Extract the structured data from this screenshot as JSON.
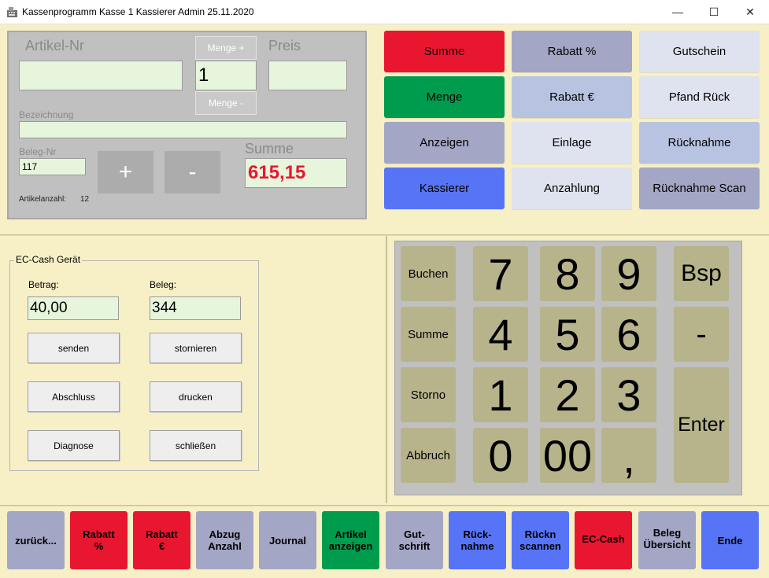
{
  "window": {
    "title": "Kassenprogramm Kasse 1  Kassierer Admin  25.11.2020",
    "minimize": "—",
    "maximize": "☐",
    "close": "✕"
  },
  "entry": {
    "artikel_label": "Artikel-Nr",
    "artikel_value": "",
    "menge_plus": "Menge +",
    "menge_value": "1",
    "menge_minus": "Menge -",
    "preis_label": "Preis",
    "preis_value": "",
    "bezeichnung_label": "Bezeichnung",
    "bezeichnung_value": "",
    "beleg_label": "Beleg-Nr",
    "beleg_value": "117",
    "plus": "+",
    "minus": "-",
    "summe_label": "Summe",
    "summe_value": "615,15",
    "artikelanzahl_label": "Artikelanzahl:",
    "artikelanzahl_value": "12"
  },
  "functions": [
    {
      "label": "Summe",
      "color": "#e8172f"
    },
    {
      "label": "Rabatt %",
      "color": "#a3a6c4"
    },
    {
      "label": "Gutschein",
      "color": "#dfe2ef"
    },
    {
      "label": "Menge",
      "color": "#009c4e"
    },
    {
      "label": "Rabatt €",
      "color": "#b7c3e1"
    },
    {
      "label": "Pfand Rück",
      "color": "#dfe2ef"
    },
    {
      "label": "Anzeigen",
      "color": "#a3a6c4"
    },
    {
      "label": "Einlage",
      "color": "#dfe2ef"
    },
    {
      "label": "Rücknahme",
      "color": "#b7c3e1"
    },
    {
      "label": "Kassierer",
      "color": "#5774f6"
    },
    {
      "label": "Anzahlung",
      "color": "#dfe2ef"
    },
    {
      "label": "Rücknahme Scan",
      "color": "#a3a6c4"
    }
  ],
  "ec": {
    "group_label": "EC-Cash Gerät",
    "betrag_label": "Betrag:",
    "betrag_value": "40,00",
    "beleg_label": "Beleg:",
    "beleg_value": "344",
    "senden": "senden",
    "stornieren": "stornieren",
    "abschluss": "Abschluss",
    "drucken": "drucken",
    "diagnose": "Diagnose",
    "schliessen": "schließen"
  },
  "keypad": {
    "buchen": "Buchen",
    "summe": "Summe",
    "storno": "Storno",
    "abbruch": "Abbruch",
    "k7": "7",
    "k8": "8",
    "k9": "9",
    "k4": "4",
    "k5": "5",
    "k6": "6",
    "k1": "1",
    "k2": "2",
    "k3": "3",
    "k0": "0",
    "k00": "00",
    "kcomma": ",",
    "bsp": "Bsp",
    "minus": "-",
    "enter": "Enter"
  },
  "bottom": [
    {
      "label": "zurück...",
      "color": "#a3a6c4"
    },
    {
      "label": "Rabatt\n%",
      "color": "#e8172f"
    },
    {
      "label": "Rabatt\n€",
      "color": "#e8172f"
    },
    {
      "label": "Abzug\nAnzahl",
      "color": "#a3a6c4"
    },
    {
      "label": "Journal",
      "color": "#a3a6c4"
    },
    {
      "label": "Artikel\nanzeigen",
      "color": "#009c4e"
    },
    {
      "label": "Gut-\nschrift",
      "color": "#a3a6c4"
    },
    {
      "label": "Rück-\nnahme",
      "color": "#5774f6"
    },
    {
      "label": "Rückn\nscannen",
      "color": "#5774f6"
    },
    {
      "label": "EC-Cash",
      "color": "#e8172f"
    },
    {
      "label": "Beleg\nÜbersicht",
      "color": "#a3a6c4"
    },
    {
      "label": "Ende",
      "color": "#5774f6"
    }
  ]
}
